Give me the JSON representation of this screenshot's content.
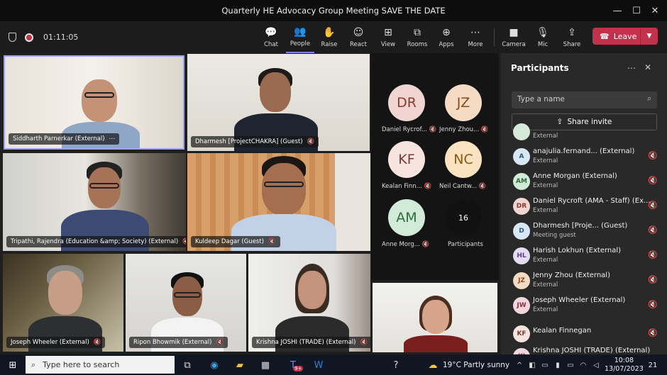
{
  "window": {
    "title": "Quarterly HE Advocacy Group Meeting SAVE THE DATE"
  },
  "meeting": {
    "timer": "01:11:05"
  },
  "toolbar": {
    "chat": "Chat",
    "people": "People",
    "raise": "Raise",
    "react": "React",
    "view": "View",
    "rooms": "Rooms",
    "apps": "Apps",
    "more": "More",
    "camera": "Camera",
    "mic": "Mic",
    "share": "Share",
    "leave": "Leave"
  },
  "tiles": [
    {
      "name": "Siddharth Parnerkar (External)",
      "extra": "⋯"
    },
    {
      "name": "Dharmesh [ProjectCHAKRA] (Guest)"
    },
    {
      "name": "Tripathi, Rajendra (Education &amp; Society) (External)"
    },
    {
      "name": "Kuldeep Dagar (Guest)"
    },
    {
      "name": "Joseph Wheeler (External)"
    },
    {
      "name": "Ripon Bhowmik (External)"
    },
    {
      "name": "Krishna JOSHI (TRADE) (External)"
    }
  ],
  "avatars": [
    {
      "initials": "DR",
      "label": "Daniel Rycrof..."
    },
    {
      "initials": "JZ",
      "label": "Jenny Zhou..."
    },
    {
      "initials": "KF",
      "label": "Kealan Finn..."
    },
    {
      "initials": "NC",
      "label": "Neil Cantw..."
    },
    {
      "initials": "AM",
      "label": "Anne Morg..."
    },
    {
      "initials": "16",
      "label": "Participants"
    }
  ],
  "panel": {
    "title": "Participants",
    "search_placeholder": "Type a name",
    "share_invite": "Share invite",
    "rows": [
      {
        "initials": "",
        "name": "",
        "sub": "External"
      },
      {
        "initials": "A",
        "name": "anajulia.fernand...  (External)",
        "sub": "External"
      },
      {
        "initials": "AM",
        "name": "Anne Morgan (External)",
        "sub": "External"
      },
      {
        "initials": "DR",
        "name": "Daniel Rycroft (AMA - Staff) (Ex...",
        "sub": "External"
      },
      {
        "initials": "D",
        "name": "Dharmesh [Proje...  (Guest)",
        "sub": "Meeting guest"
      },
      {
        "initials": "HL",
        "name": "Harish Lokhun (External)",
        "sub": "External"
      },
      {
        "initials": "JZ",
        "name": "Jenny Zhou (External)",
        "sub": "External"
      },
      {
        "initials": "JW",
        "name": "Joseph Wheeler (External)",
        "sub": "External"
      },
      {
        "initials": "KF",
        "name": "Kealan Finnegan",
        "sub": ""
      },
      {
        "initials": "KJ",
        "name": "Krishna JOSHI (TRADE) (External)",
        "sub": ""
      }
    ]
  },
  "taskbar": {
    "search": "Type here to search",
    "weather": "19°C  Partly sunny",
    "time": "10:08",
    "date": "13/07/2023",
    "notif": "21",
    "teams_badge": "9+"
  }
}
